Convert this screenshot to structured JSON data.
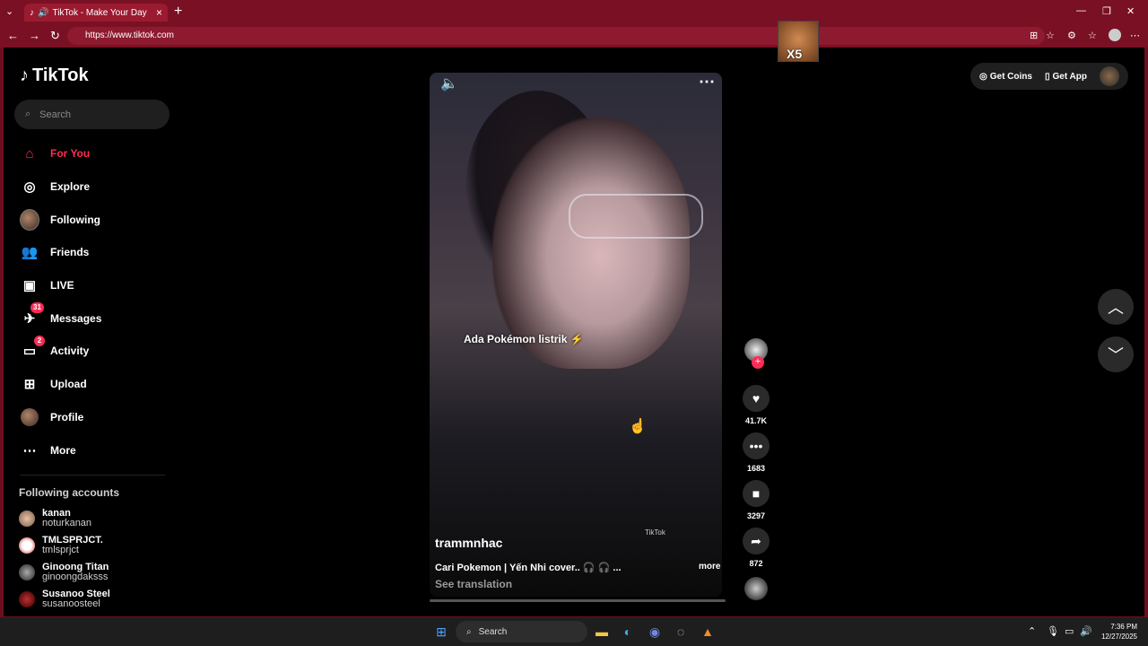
{
  "browser": {
    "tab_title": "TikTok - Make Your Day",
    "url": "https://www.tiktok.com"
  },
  "tiktok": {
    "logo": "TikTok",
    "search_placeholder": "Search",
    "nav": [
      {
        "label": "For You",
        "icon": "home-icon",
        "active": true
      },
      {
        "label": "Explore",
        "icon": "compass-icon"
      },
      {
        "label": "Following",
        "icon": "following-avatar"
      },
      {
        "label": "Friends",
        "icon": "friends-icon"
      },
      {
        "label": "LIVE",
        "icon": "live-icon"
      },
      {
        "label": "Messages",
        "icon": "messages-icon",
        "badge": "31"
      },
      {
        "label": "Activity",
        "icon": "activity-icon",
        "badge": "2"
      },
      {
        "label": "Upload",
        "icon": "upload-icon"
      },
      {
        "label": "Profile",
        "icon": "profile-avatar"
      },
      {
        "label": "More",
        "icon": "more-icon"
      }
    ],
    "following_title": "Following accounts",
    "following": [
      {
        "name": "kanan",
        "handle": "noturkanan"
      },
      {
        "name": "TMLSPRJCT.",
        "handle": "tmlsprjct"
      },
      {
        "name": "Ginoong Titan",
        "handle": "ginoongdaksss"
      },
      {
        "name": "Susanoo Steel",
        "handle": "susanoosteel"
      }
    ],
    "top_right": {
      "coins": "Get Coins",
      "app": "Get App"
    },
    "video": {
      "caption": "Ada Pokémon listrik ⚡",
      "watermark": "TikTok",
      "username": "trammnhac",
      "description": "Cari Pokemon | Yến Nhi cover.. 🎧 🎧 ...",
      "more": "more",
      "see_translation": "See translation",
      "likes": "41.7K",
      "comments": "1683",
      "saves": "3297",
      "shares": "872"
    },
    "sticker_text": "X5"
  },
  "taskbar": {
    "search": "Search",
    "time": "7:36 PM",
    "date": "12/27/2025"
  },
  "colors": {
    "accent": "#fe2c55",
    "browser_frame": "#7a1024"
  }
}
